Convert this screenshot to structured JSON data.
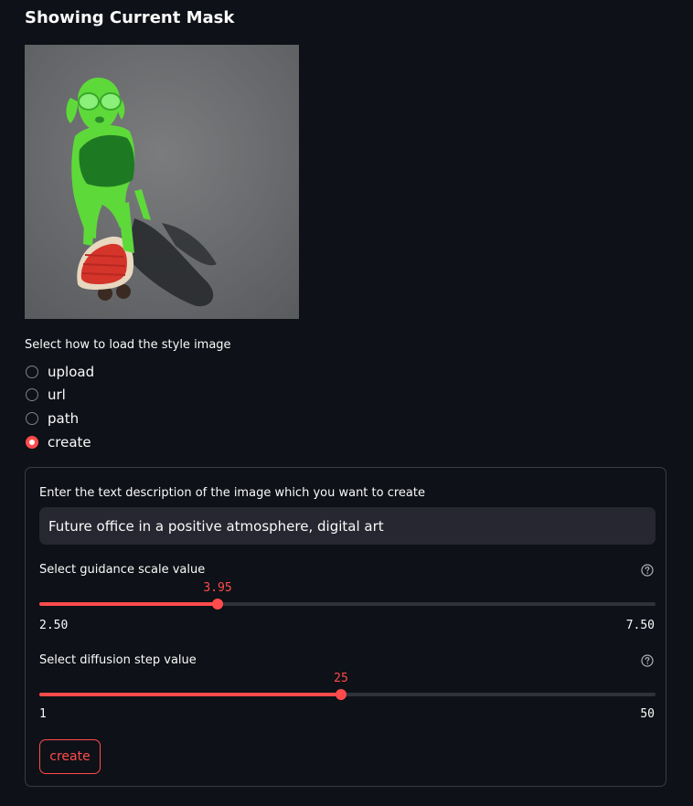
{
  "page": {
    "title": "Showing Current Mask"
  },
  "mask_image": {
    "icon": "dog-on-skateboard-image"
  },
  "style_source": {
    "label": "Select how to load the style image",
    "options": [
      "upload",
      "url",
      "path",
      "create"
    ],
    "selected": "create"
  },
  "create_panel": {
    "description_label": "Enter the text description of the image which you want to create",
    "description_value": "Future office in a positive atmosphere, digital art",
    "guidance": {
      "label": "Select guidance scale value",
      "value": "3.95",
      "min": "2.50",
      "max": "7.50",
      "fraction": 0.29
    },
    "diffusion": {
      "label": "Select diffusion step value",
      "value": "25",
      "min": "1",
      "max": "50",
      "fraction": 0.49
    },
    "create_label": "create"
  },
  "colors": {
    "accent": "#ff4b4b",
    "background": "#0e1117",
    "input_bg": "#262730"
  }
}
